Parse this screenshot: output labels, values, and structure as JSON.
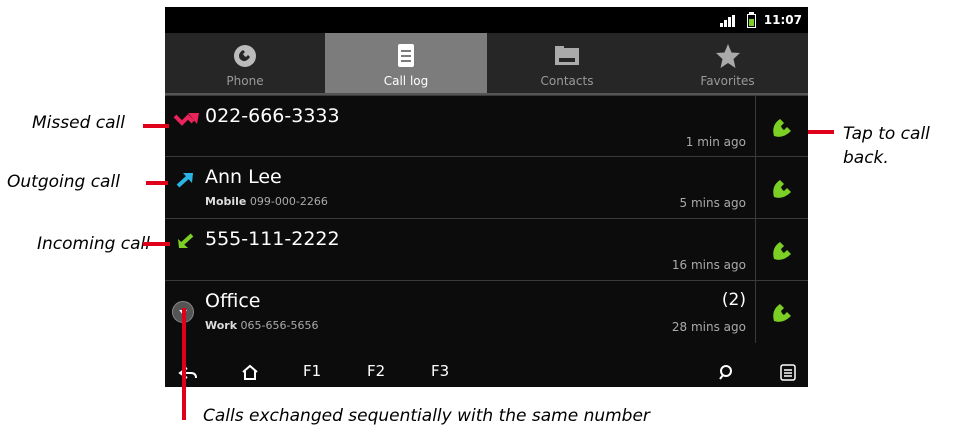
{
  "status": {
    "time": "11:07"
  },
  "tabs": [
    {
      "label": "Phone",
      "icon": "phone-icon"
    },
    {
      "label": "Call log",
      "icon": "call-log-icon"
    },
    {
      "label": "Contacts",
      "icon": "contacts-icon"
    },
    {
      "label": "Favorites",
      "icon": "star-icon"
    }
  ],
  "calls": [
    {
      "name": "022-666-3333",
      "type": "",
      "number": "",
      "time": "1 min ago",
      "count": "",
      "status_icon": "missed-call-icon"
    },
    {
      "name": "Ann Lee",
      "type": "Mobile",
      "number": "099-000-2266",
      "time": "5 mins ago",
      "count": "",
      "status_icon": "outgoing-call-icon"
    },
    {
      "name": "555-111-2222",
      "type": "",
      "number": "",
      "time": "16 mins ago",
      "count": "",
      "status_icon": "incoming-call-icon"
    },
    {
      "name": "Office",
      "type": "Work",
      "number": "065-656-5656",
      "time": "28 mins ago",
      "count": "(2)",
      "status_icon": "expand-icon"
    }
  ],
  "navbar": {
    "f1": "F1",
    "f2": "F2",
    "f3": "F3"
  },
  "callouts": {
    "missed": "Missed call",
    "outgoing": "Outgoing call",
    "incoming": "Incoming call",
    "tap": "Tap to call back.",
    "sequential": "Calls exchanged sequentially with the same number"
  },
  "colors": {
    "missed": "#e8245a",
    "outgoing": "#2bb3e6",
    "incoming": "#7ccf24",
    "call_button": "#7ccf24",
    "callout_bar": "#e0001a"
  }
}
